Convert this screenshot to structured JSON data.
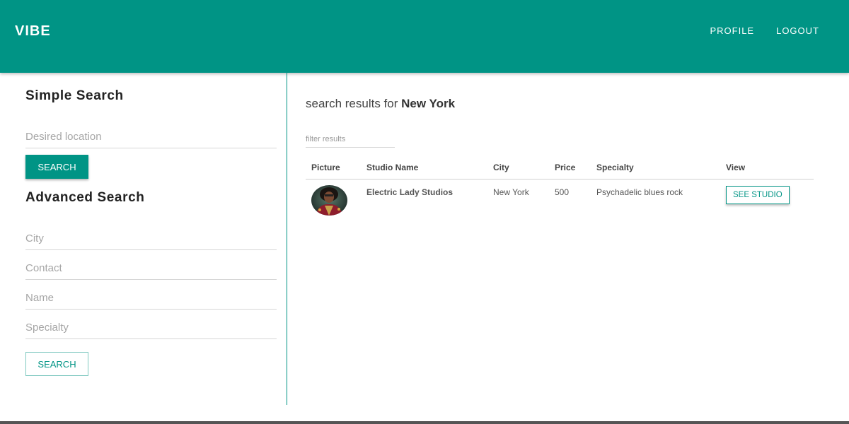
{
  "header": {
    "brand": "VIBE",
    "nav": {
      "profile": "PROFILE",
      "logout": "LOGOUT"
    }
  },
  "sidebar": {
    "simple": {
      "title": "Simple Search",
      "location_placeholder": "Desired location",
      "location_value": "",
      "button": "SEARCH"
    },
    "advanced": {
      "title": "Advanced Search",
      "city_placeholder": "City",
      "contact_placeholder": "Contact",
      "name_placeholder": "Name",
      "specialty_placeholder": "Specialty",
      "button": "SEARCH"
    }
  },
  "results": {
    "prefix": "search results for",
    "query": "New York",
    "filter_placeholder": "filter results",
    "columns": [
      "Picture",
      "Studio Name",
      "City",
      "Price",
      "Specialty",
      "View"
    ],
    "rows": [
      {
        "picture": "studio-avatar",
        "name": "Electric Lady Studios",
        "city": "New York",
        "price": "500",
        "specialty": "Psychadelic blues rock",
        "view": "SEE STUDIO"
      }
    ]
  },
  "colors": {
    "accent": "#009485",
    "background": "#ffffff",
    "text": "#333333"
  }
}
